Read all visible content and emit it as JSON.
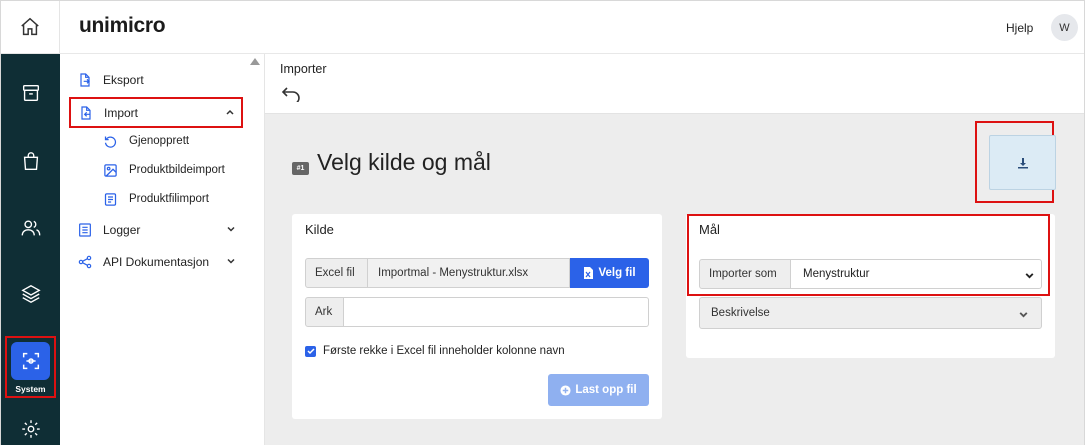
{
  "app": {
    "logo": "unimicro",
    "help": "Hjelp",
    "avatar_initial": "W"
  },
  "rail": {
    "system_label": "System"
  },
  "subnav": {
    "eksport": "Eksport",
    "import": "Import",
    "gjenopprett": "Gjenopprett",
    "produktbildeimport": "Produktbildeimport",
    "produktfilimport": "Produktfilimport",
    "logger": "Logger",
    "api": "API Dokumentasjon"
  },
  "main": {
    "breadcrumb": "Importer",
    "step_badge": "#1",
    "title": "Velg kilde og mål"
  },
  "kilde": {
    "title": "Kilde",
    "excel_label": "Excel fil",
    "file_name": "Importmal - Menystruktur.xlsx",
    "choose_file": "Velg fil",
    "sheet_label": "Ark",
    "sheet_value": "",
    "first_row_checkbox": "Første rekke i Excel fil inneholder kolonne navn",
    "first_row_checked": true,
    "upload": "Last opp fil"
  },
  "maal": {
    "title": "Mål",
    "import_as_label": "Importer som",
    "import_as_value": "Menystruktur",
    "description": "Beskrivelse"
  },
  "colors": {
    "primary": "#2b62e8",
    "rail": "#0f2e35",
    "highlight": "#dd1111"
  }
}
